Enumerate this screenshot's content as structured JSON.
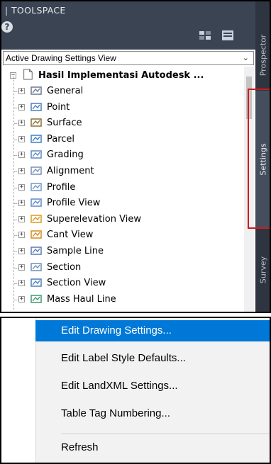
{
  "toolspace": {
    "title": "TOOLSPACE",
    "view_selector": "Active Drawing Settings View",
    "tree": {
      "root_label": "Hasil Implementasi Autodesk ...",
      "items": [
        {
          "label": "General",
          "icon": "general-icon"
        },
        {
          "label": "Point",
          "icon": "point-icon"
        },
        {
          "label": "Surface",
          "icon": "surface-icon"
        },
        {
          "label": "Parcel",
          "icon": "parcel-icon"
        },
        {
          "label": "Grading",
          "icon": "grading-icon"
        },
        {
          "label": "Alignment",
          "icon": "alignment-icon"
        },
        {
          "label": "Profile",
          "icon": "profile-icon"
        },
        {
          "label": "Profile View",
          "icon": "profile-view-icon"
        },
        {
          "label": "Superelevation View",
          "icon": "superelevation-view-icon"
        },
        {
          "label": "Cant View",
          "icon": "cant-view-icon"
        },
        {
          "label": "Sample Line",
          "icon": "sample-line-icon"
        },
        {
          "label": "Section",
          "icon": "section-icon"
        },
        {
          "label": "Section View",
          "icon": "section-view-icon"
        },
        {
          "label": "Mass Haul Line",
          "icon": "mass-haul-line-icon"
        }
      ]
    },
    "tabs": {
      "prospector": "Prospector",
      "settings": "Settings",
      "survey": "Survey"
    }
  },
  "context_menu": {
    "items": [
      {
        "label": "Edit Drawing Settings...",
        "active": true
      },
      {
        "label": "Edit Label Style Defaults..."
      },
      {
        "label": "Edit LandXML Settings..."
      },
      {
        "label": "Table Tag Numbering..."
      }
    ],
    "refresh": "Refresh"
  },
  "colors": {
    "titlebar": "#3b4453",
    "tab_strip": "#2e3540",
    "highlight_border": "#d11a1a",
    "menu_active": "#0078d7"
  }
}
